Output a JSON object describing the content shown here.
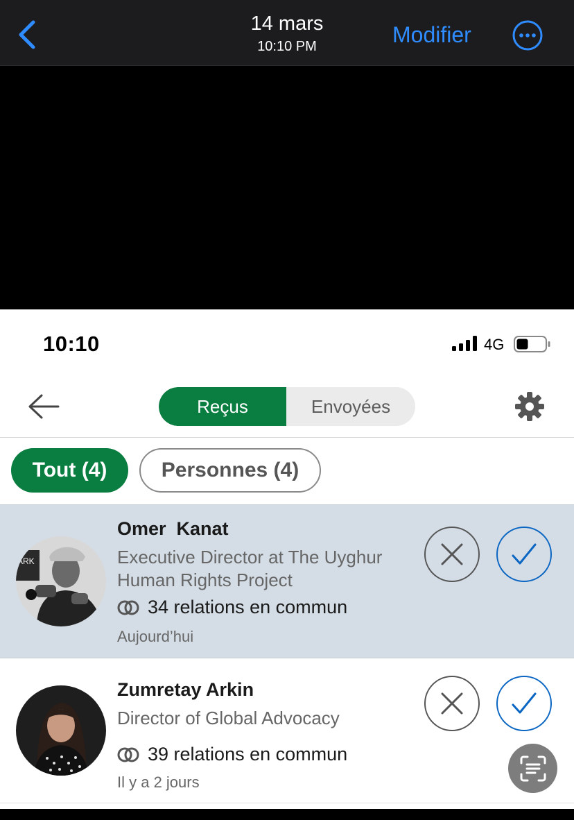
{
  "viewer": {
    "date": "14 mars",
    "time": "10:10 PM",
    "edit_label": "Modifier",
    "back_icon": "chevron-left-icon",
    "more_icon": "ellipsis-circle-icon",
    "accent": "#2f8cff"
  },
  "status_bar": {
    "time": "10:10",
    "network": "4G"
  },
  "header": {
    "tabs": [
      {
        "label": "Reçus",
        "selected": true
      },
      {
        "label": "Envoyées",
        "selected": false
      }
    ],
    "back_icon": "arrow-left-icon",
    "settings_icon": "gear-icon"
  },
  "filters": [
    {
      "label": "Tout (4)",
      "selected": true
    },
    {
      "label": "Personnes (4)",
      "selected": false
    }
  ],
  "invitations": [
    {
      "name": "Omer  Kanat",
      "headline": "Executive Director at The Uyghur Human Rights Project",
      "mutual": "34 relations en commun",
      "when": "Aujourd’hui",
      "highlighted": true
    },
    {
      "name": "Zumretay Arkin",
      "headline": "Director of Global Advocacy",
      "mutual": "39 relations en commun",
      "when": "Il y a 2 jours",
      "highlighted": false
    }
  ],
  "colors": {
    "brand_green": "#0a7d41",
    "accept_blue": "#0a66c2",
    "highlight_row": "#d4dde6"
  }
}
